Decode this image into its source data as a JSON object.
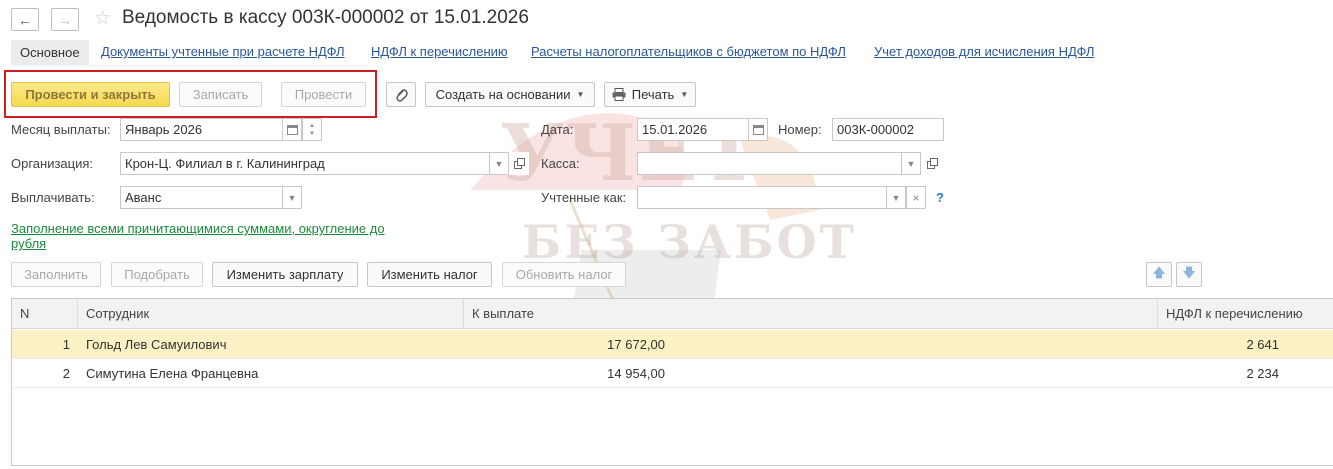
{
  "header": {
    "back_icon": "arrow-left-icon",
    "forward_icon": "arrow-right-icon",
    "favorite_icon": "star-icon",
    "title": "Ведомость в кассу 003К-000002 от 15.01.2026"
  },
  "tabs": [
    {
      "label": "Основное",
      "active": true
    },
    {
      "label": "Документы учтенные при расчете НДФЛ"
    },
    {
      "label": "НДФЛ к перечислению"
    },
    {
      "label": "Расчеты налогоплательщиков с бюджетом по НДФЛ"
    },
    {
      "label": "Учет доходов для исчисления НДФЛ"
    }
  ],
  "toolbar": {
    "post_close": "Провести и закрыть",
    "save": "Записать",
    "post": "Провести",
    "attach_icon": "paperclip-icon",
    "create_based": "Создать на основании",
    "print_icon": "printer-icon",
    "print": "Печать"
  },
  "form": {
    "month_label": "Месяц выплаты:",
    "month_value": "Январь 2026",
    "date_label": "Дата:",
    "date_value": "15.01.2026",
    "number_label": "Номер:",
    "number_value": "003К-000002",
    "org_label": "Организация:",
    "org_value": "Крон-Ц. Филиал в г. Калининград",
    "cash_label": "Касса:",
    "cash_value": "",
    "pay_label": "Выплачивать:",
    "pay_value": "Аванс",
    "accounted_label": "Учтенные как:",
    "accounted_value": "",
    "help": "?",
    "fill_link": "Заполнение всеми причитающимися суммами, округление до рубля"
  },
  "actions": {
    "fill": "Заполнить",
    "select": "Подобрать",
    "change_salary": "Изменить зарплату",
    "change_tax": "Изменить налог",
    "refresh_tax": "Обновить налог"
  },
  "table": {
    "columns": [
      "N",
      "Сотрудник",
      "К выплате",
      "НДФЛ к перечислению"
    ],
    "rows": [
      {
        "n": "1",
        "employee": "Гольд Лев Самуилович",
        "payout": "17 672,00",
        "tax": "2 641",
        "selected": true
      },
      {
        "n": "2",
        "employee": "Симутина Елена Францевна",
        "payout": "14 954,00",
        "tax": "2 234"
      }
    ]
  },
  "watermark": {
    "line1": "УЧЕТ",
    "line2": "БЕЗ ЗАБОТ"
  },
  "colors": {
    "primary_button": "#f6d84f",
    "link": "#2b5797",
    "green_link": "#1b8a3a",
    "highlight_box": "#cc1f1f",
    "selected_row": "#fbf1c4"
  }
}
